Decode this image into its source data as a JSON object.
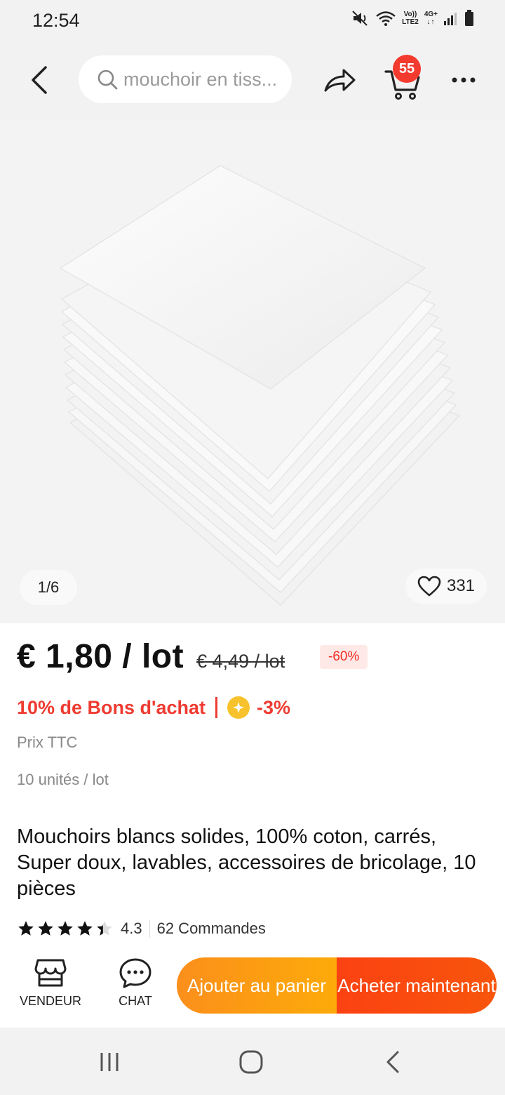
{
  "status_bar": {
    "time": "12:54",
    "network_top": "Vo))",
    "network_bottom": "LTE2",
    "network_type": "4G+"
  },
  "nav": {
    "search_placeholder": "mouchoir en tiss...",
    "cart_count": "55",
    "icons": [
      "back-arrow-icon",
      "search-icon",
      "share-icon",
      "cart-icon",
      "more-icon"
    ]
  },
  "gallery": {
    "counter": "1/6",
    "favorites": "331"
  },
  "price": {
    "current": "€ 1,80 / lot",
    "original": "€ 4,49 / lot",
    "discount": "-60%"
  },
  "coupon": {
    "label": "10% de Bons d'achat",
    "coin_discount": "-3%"
  },
  "tax_note": "Prix TTC",
  "unit_note": "10 unités / lot",
  "title": "Mouchoirs blancs solides, 100% coton, carrés, Super doux, lavables, accessoires de bricolage, 10 pièces",
  "rating": {
    "value": "4.3",
    "stars": 4.3,
    "orders": "62 Commandes"
  },
  "actions": {
    "vendor_label": "VENDEUR",
    "chat_label": "CHAT",
    "add_to_cart": "Ajouter au panier",
    "buy_now": "Acheter maintenant"
  },
  "colors": {
    "accent_red": "#ee3b31",
    "badge_red": "#f33a2e",
    "add_cart_orange": "#fb8f1b",
    "buy_now_orange": "#fb4212",
    "coin_yellow": "#f7c22b"
  }
}
